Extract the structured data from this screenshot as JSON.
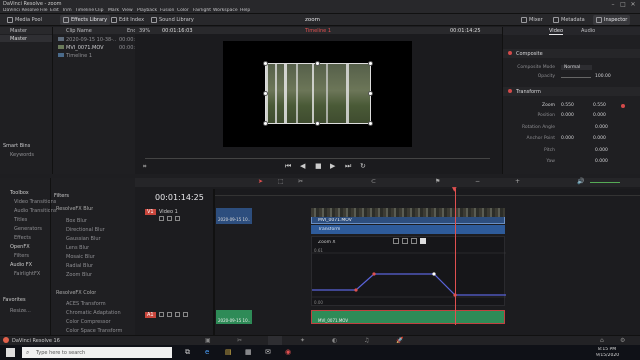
{
  "app": {
    "title": "DaVinci Resolve - zoom",
    "menu": [
      "DaVinci Resolve",
      "File",
      "Edit",
      "Trim",
      "Timeline",
      "Clip",
      "Mark",
      "View",
      "Playback",
      "Fusion",
      "Color",
      "Fairlight",
      "Workspace",
      "Help"
    ],
    "project_name": "zoom"
  },
  "toolbar": {
    "media_pool": "Media Pool",
    "effects_library": "Effects Library",
    "edit_index": "Edit Index",
    "sound_library": "Sound Library",
    "mixer": "Mixer",
    "metadata": "Metadata",
    "inspector": "Inspector"
  },
  "media_pool": {
    "bin_header": "Master",
    "column_clip_name": "Clip Name",
    "column_end_tc": "End TC",
    "bins": [
      "Master"
    ],
    "clips": [
      {
        "name": "2020-09-15 10-38-...",
        "tc": "00:00:..."
      },
      {
        "name": "MVI_0071.MOV",
        "tc": "00:00:04:2..."
      },
      {
        "name": "Timeline 1",
        "tc": "00:04:2..."
      }
    ],
    "smart_bins": "Smart Bins",
    "keywords": "Keywords"
  },
  "viewer": {
    "zoom": "39%",
    "timecode_left": "00:01:16:03",
    "timeline_name": "Timeline 1",
    "timecode_right": "00:01:14:25"
  },
  "inspector": {
    "tab_video": "Video",
    "tab_audio": "Audio",
    "composite_header": "Composite",
    "composite_mode_label": "Composite Mode",
    "composite_mode_value": "Normal",
    "opacity_label": "Opacity",
    "opacity_value": "100.00",
    "transform_header": "Transform",
    "zoom_label": "Zoom",
    "zoom_x": "0.550",
    "zoom_y": "0.550",
    "position_label": "Position",
    "position_x": "0.000",
    "position_y": "0.000",
    "rotation_label": "Rotation Angle",
    "rotation_value": "0.000",
    "anchor_label": "Anchor Point",
    "anchor_x": "0.000",
    "anchor_y": "0.000",
    "pitch_label": "Pitch",
    "pitch_value": "0.000",
    "yaw_label": "Yaw",
    "yaw_value": "0.000"
  },
  "effects": {
    "toolbox": "Toolbox",
    "items": [
      "Video Transitions",
      "Audio Transitions",
      "Titles",
      "Generators",
      "Effects"
    ],
    "openfx": "OpenFX",
    "openfx_items": [
      "Filters"
    ],
    "audio_fx": "Audio FX",
    "audio_fx_items": [
      "FairlightFX"
    ],
    "favorites": "Favorites",
    "favorite_item": "Resize..."
  },
  "filters": {
    "header": "Filters",
    "group1": "ResolveFX Blur",
    "blur_items": [
      "Box Blur",
      "Directional Blur",
      "Gaussian Blur",
      "Lens Blur",
      "Mosaic Blur",
      "Radial Blur",
      "Zoom Blur"
    ],
    "group2": "ResolveFX Color",
    "color_items": [
      "ACES Transform",
      "Chromatic Adaptation",
      "Color Compressor",
      "Color Space Transform"
    ]
  },
  "timeline": {
    "timecode": "00:01:14:25",
    "track_v1_label": "V1",
    "track_v1_name": "Video 1",
    "track_a1_label": "A1",
    "clip_left_name": "2020-09-15 10...",
    "clip_video_name": "MVI_0071.MOV",
    "clip_transform_label": "Transform",
    "keyframe_label": "Zoom X",
    "key_value_top": "0.61",
    "key_value_bottom": "0.00",
    "audio_clip_name": "MVI_0071.MOV",
    "audio_left_name": "2020-09-15 10..."
  },
  "status": {
    "app_version": "DaVinci Resolve 16"
  },
  "taskbar": {
    "search_placeholder": "Type here to search",
    "time": "8:15 PM",
    "date": "9/15/2020"
  }
}
